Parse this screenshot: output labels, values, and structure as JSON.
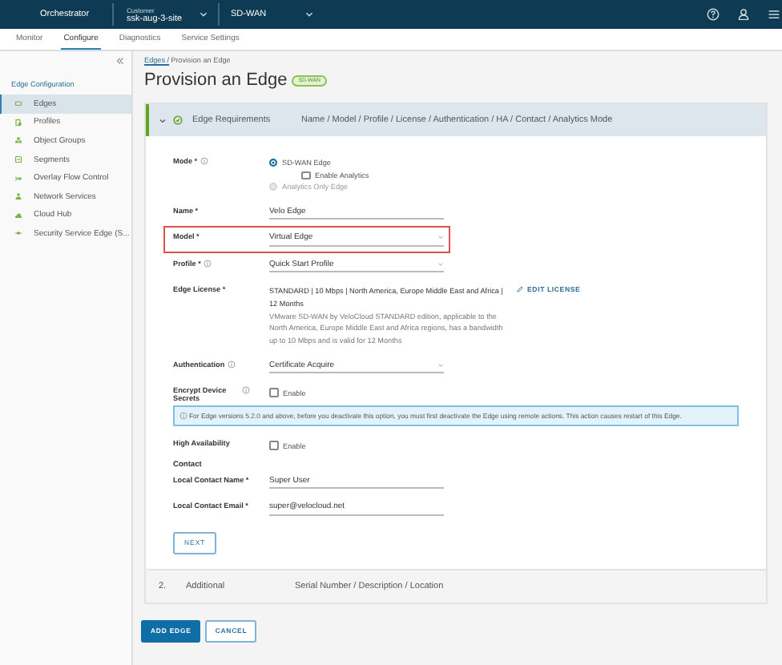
{
  "header": {
    "brand": "Orchestrator",
    "customer_label": "Customer",
    "customer": "ssk-aug-3-site",
    "product": "SD-WAN"
  },
  "nav_tabs": [
    {
      "label": "Monitor",
      "selected": false
    },
    {
      "label": "Configure",
      "selected": true
    },
    {
      "label": "Diagnostics",
      "selected": false
    },
    {
      "label": "Service Settings",
      "selected": false
    }
  ],
  "sidebar": {
    "section": "Edge Configuration",
    "items": [
      {
        "label": "Edges",
        "selected": true
      },
      {
        "label": "Profiles",
        "selected": false
      },
      {
        "label": "Object Groups",
        "selected": false
      },
      {
        "label": "Segments",
        "selected": false
      },
      {
        "label": "Overlay Flow Control",
        "selected": false
      },
      {
        "label": "Network Services",
        "selected": false
      },
      {
        "label": "Cloud Hub",
        "selected": false
      },
      {
        "label": "Security Service Edge (S...",
        "selected": false
      }
    ]
  },
  "breadcrumb": {
    "link": "Edges /",
    "current": "Provision an Edge"
  },
  "page_title": "Provision an Edge",
  "badge": "SD-WAN",
  "steps": [
    {
      "title": "Edge Requirements",
      "summary": "Name / Model / Profile / License / Authentication / HA / Contact / Analytics Mode",
      "expanded": true
    },
    {
      "number": "2.",
      "title": "Additional",
      "summary": "Serial Number / Description / Location",
      "expanded": false
    }
  ],
  "form": [
    {
      "kind": "mode",
      "label": "Mode *",
      "info": true,
      "options": [
        {
          "label": "SD-WAN Edge",
          "selected": true,
          "disabled": false,
          "sub_option": {
            "label": "Enable Analytics",
            "checked": false
          }
        },
        {
          "label": "Analytics Only Edge",
          "selected": false,
          "disabled": true
        }
      ]
    },
    {
      "kind": "text",
      "label": "Name *",
      "value": "Velo Edge"
    },
    {
      "kind": "select",
      "label": "Model *",
      "value": "Virtual Edge",
      "highlighted": true
    },
    {
      "kind": "select",
      "label": "Profile *",
      "info": true,
      "value": "Quick Start Profile"
    },
    {
      "kind": "license",
      "label": "Edge License *",
      "value": "STANDARD | 10 Mbps | North America, Europe Middle East and Africa | 12 Months",
      "description": "VMware SD-WAN by VeloCloud STANDARD edition, applicable to the North America, Europe Middle East and Africa regions, has a bandwidth up to 10 Mbps and is valid for 12 Months",
      "action": "EDIT LICENSE"
    },
    {
      "kind": "select",
      "label": "Authentication",
      "info": true,
      "value": "Certificate Acquire"
    },
    {
      "kind": "checkbox",
      "label": "Encrypt Device Secrets",
      "info": true,
      "option": "Enable",
      "checked": false
    },
    {
      "kind": "alert",
      "text": "For Edge versions 5.2.0 and above, before you deactivate this option, you must first deactivate the Edge using remote actions. This action causes restart of this Edge."
    },
    {
      "kind": "checkbox",
      "label": "High Availability",
      "option": "Enable",
      "checked": false
    },
    {
      "kind": "heading",
      "label": "Contact"
    },
    {
      "kind": "text",
      "label": "Local Contact Name *",
      "value": "Super User"
    },
    {
      "kind": "text",
      "label": "Local Contact Email *",
      "value": "super@velocloud.net"
    },
    {
      "kind": "button",
      "label": "NEXT"
    }
  ],
  "buttons": [
    {
      "label": "ADD EDGE",
      "kind": "primary"
    },
    {
      "label": "CANCEL",
      "kind": "secondary"
    }
  ]
}
